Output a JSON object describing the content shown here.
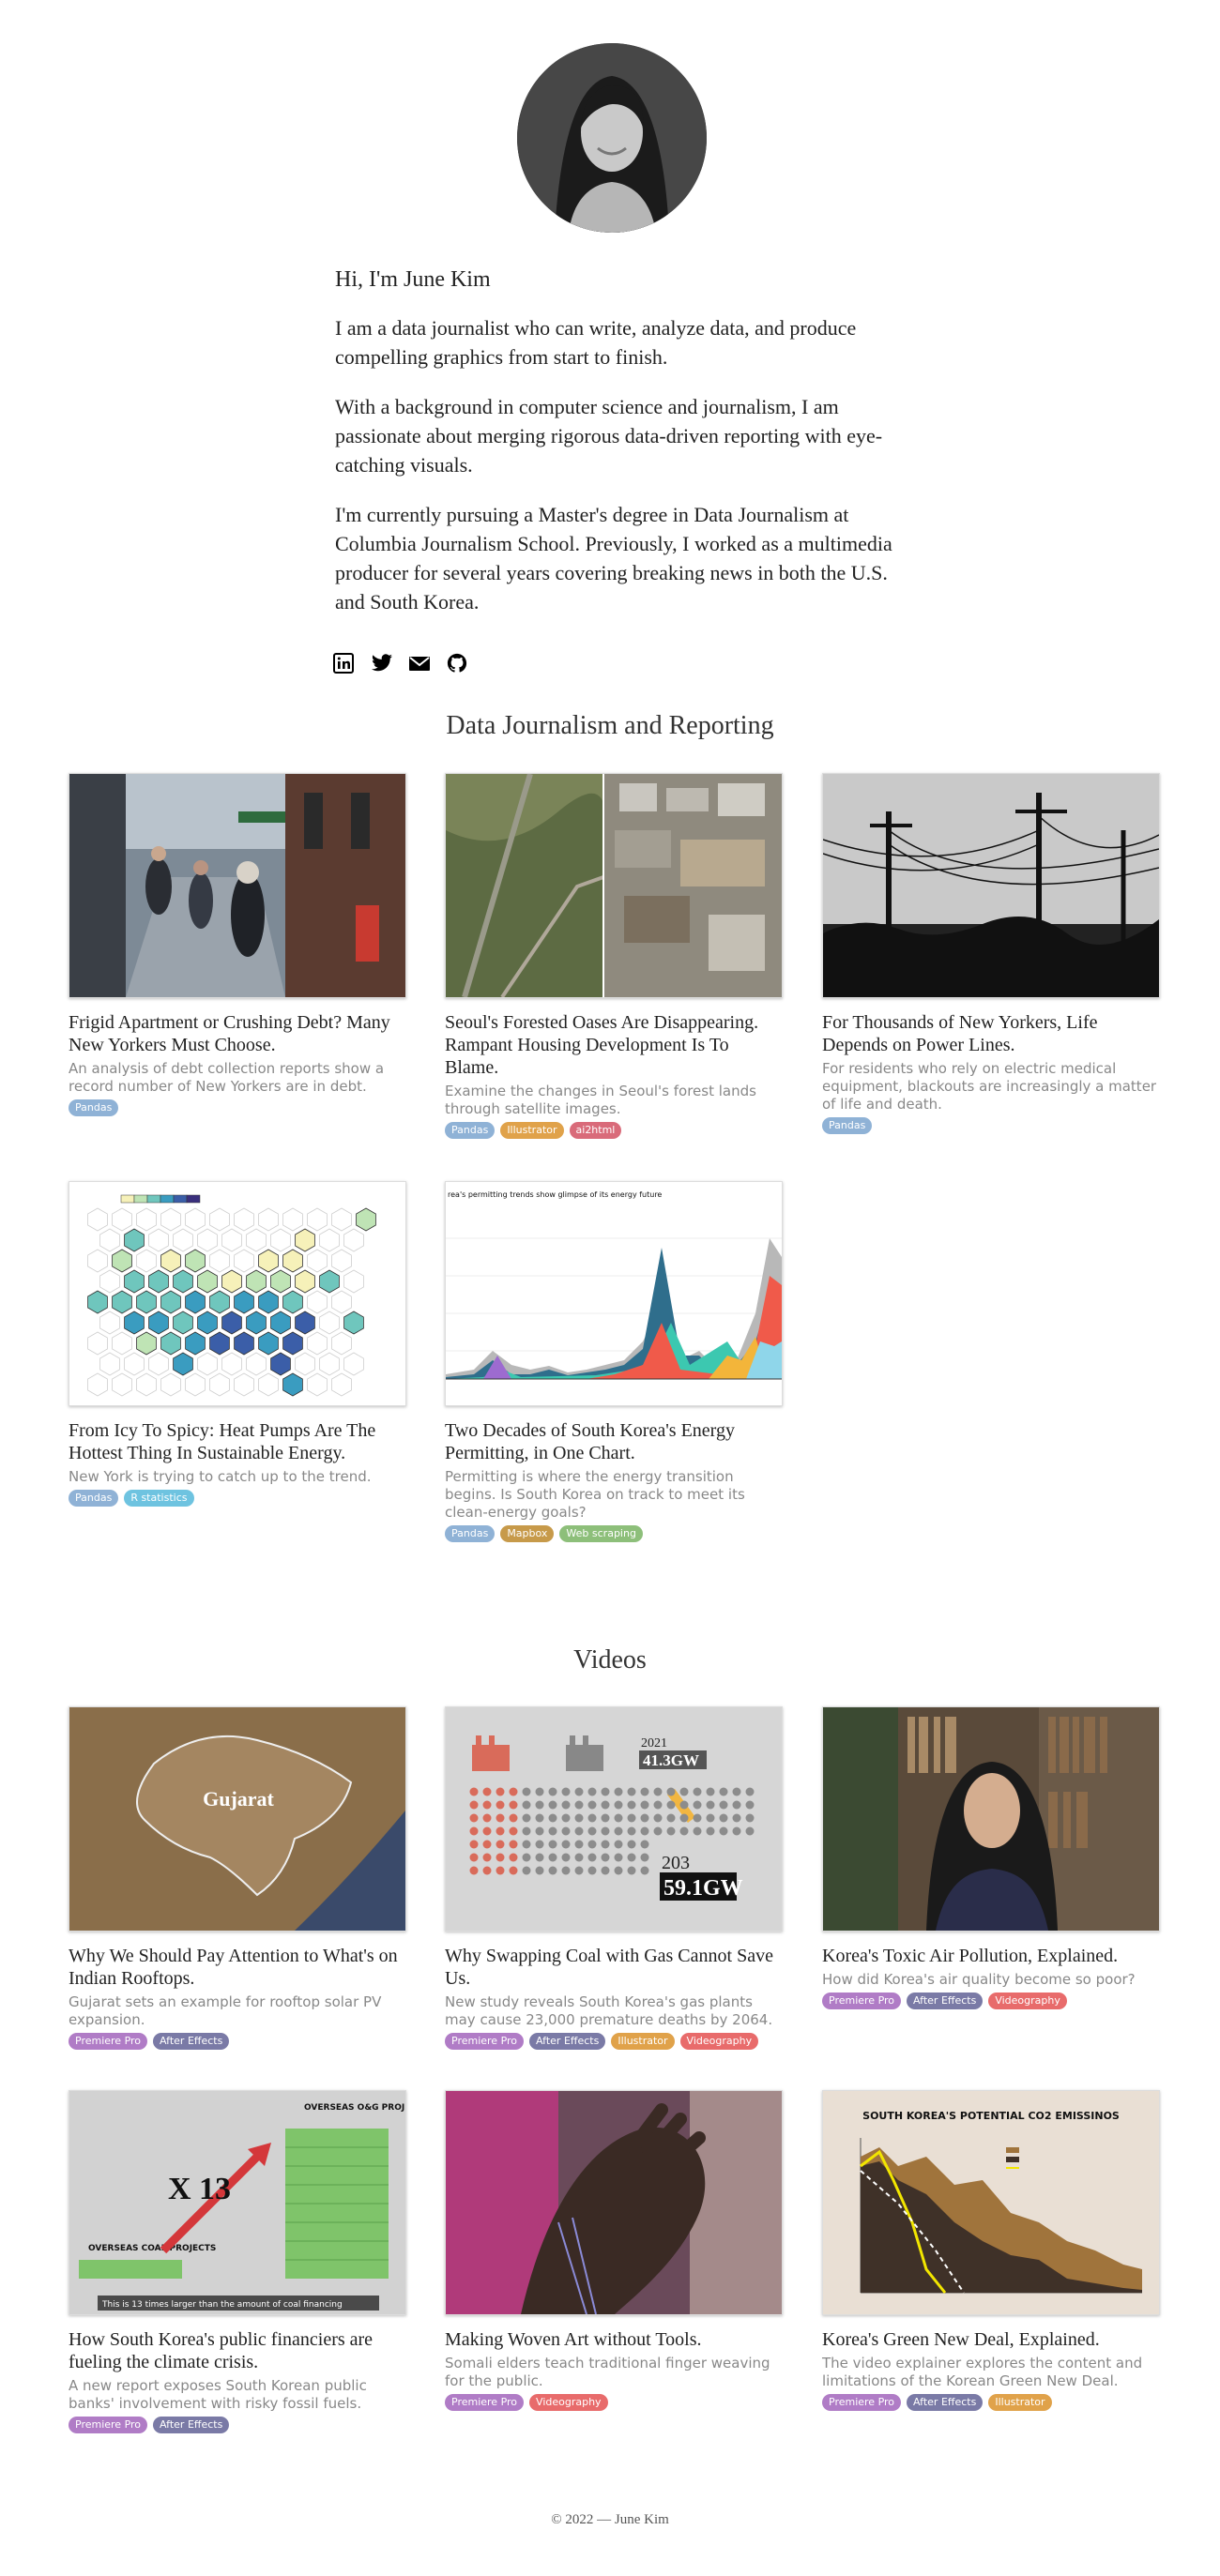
{
  "intro": {
    "greeting": "Hi, I'm June Kim",
    "paragraphs": [
      "I am a data journalist who can write, analyze data, and produce compelling graphics from start to finish.",
      "With a background in computer science and journalism, I am passionate about merging rigorous data-driven reporting with eye-catching visuals.",
      "I'm currently pursuing a Master's degree in Data Journalism at Columbia Journalism School. Previously, I worked as a multimedia producer for several years covering breaking news in both the U.S. and South Korea."
    ]
  },
  "social": [
    "linkedin-icon",
    "twitter-icon",
    "email-icon",
    "github-icon"
  ],
  "tag_colors": {
    "Pandas": "#8fb2d6",
    "Illustrator": "#e0a24a",
    "ai2html": "#d96b7a",
    "R statistics": "#6ec3e0",
    "Mapbox": "#c79a4a",
    "Web scraping": "#8dbf7a",
    "Premiere Pro": "#b07cc6",
    "After Effects": "#7a7aa6",
    "Videography": "#e86b6b"
  },
  "journalism": {
    "title": "Data Journalism and Reporting",
    "cards": [
      {
        "title": "Frigid Apartment or Crushing Debt? Many New Yorkers Must Choose.",
        "desc": "An analysis of debt collection reports show a record number of New Yorkers are in debt.",
        "tags": [
          "Pandas"
        ]
      },
      {
        "title": "Seoul's Forested Oases Are Disappearing. Rampant Housing Development Is To Blame.",
        "desc": "Examine the changes in Seoul's forest lands through satellite images.",
        "tags": [
          "Pandas",
          "Illustrator",
          "ai2html"
        ]
      },
      {
        "title": "For Thousands of New Yorkers, Life Depends on Power Lines.",
        "desc": "For residents who rely on electric medical equipment, blackouts are increasingly a matter of life and death.",
        "tags": [
          "Pandas"
        ]
      },
      {
        "title": "From Icy To Spicy: Heat Pumps Are The Hottest Thing In Sustainable Energy.",
        "desc": "New York is trying to catch up to the trend.",
        "tags": [
          "Pandas",
          "R statistics"
        ]
      },
      {
        "title": "Two Decades of South Korea's Energy Permitting, in One Chart.",
        "desc": "Permitting is where the energy transition begins. Is South Korea on track to meet its clean-energy goals?",
        "tags": [
          "Pandas",
          "Mapbox",
          "Web scraping"
        ]
      }
    ]
  },
  "videos": {
    "title": "Videos",
    "cards": [
      {
        "title": "Why We Should Pay Attention to What's on Indian Rooftops.",
        "desc": "Gujarat sets an example for rooftop solar PV expansion.",
        "tags": [
          "Premiere Pro",
          "After Effects"
        ],
        "thumb_text": "Gujarat"
      },
      {
        "title": "Why Swapping Coal with Gas Cannot Save Us.",
        "desc": "New study reveals South Korea's gas plants may cause 23,000 premature deaths by 2064.",
        "tags": [
          "Premiere Pro",
          "After Effects",
          "Illustrator",
          "Videography"
        ],
        "thumb_year1": "2021",
        "thumb_val1": "41.3GW",
        "thumb_year2": "203",
        "thumb_val2": "59.1GW"
      },
      {
        "title": "Korea's Toxic Air Pollution, Explained.",
        "desc": "How did Korea's air quality become so poor?",
        "tags": [
          "Premiere Pro",
          "After Effects",
          "Videography"
        ]
      },
      {
        "title": "How South Korea's public financiers are fueling the climate crisis.",
        "desc": "A new report exposes South Korean public banks' involvement with risky fossil fuels.",
        "tags": [
          "Premiere Pro",
          "After Effects"
        ],
        "thumb_left": "OVERSEAS COAL PROJECTS",
        "thumb_right": "OVERSEAS O&G PROJECTS",
        "thumb_mult": "X 13",
        "thumb_caption": "This is 13 times larger than the amount of coal financing"
      },
      {
        "title": "Making Woven Art without Tools.",
        "desc": "Somali elders teach traditional finger weaving for the public.",
        "tags": [
          "Premiere Pro",
          "Videography"
        ]
      },
      {
        "title": "Korea's Green New Deal, Explained.",
        "desc": "The video explainer explores the content and limitations of the Korean Green New Deal.",
        "tags": [
          "Premiere Pro",
          "After Effects",
          "Illustrator"
        ],
        "thumb_title": "SOUTH KOREA'S POTENTIAL CO2 EMISSINOS"
      }
    ]
  },
  "footer": "© 2022 — June Kim"
}
